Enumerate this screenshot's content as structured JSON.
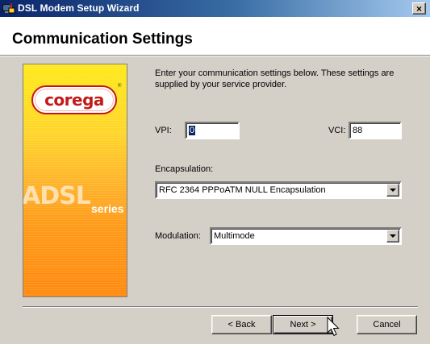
{
  "window": {
    "title": "DSL Modem Setup Wizard",
    "close_glyph": "×"
  },
  "header": {
    "title": "Communication Settings"
  },
  "banner": {
    "logo_text": "corega",
    "logo_reg": "®",
    "product_text": "ADSL",
    "series_text": "series"
  },
  "content": {
    "intro": "Enter your communication settings below.  These settings are supplied by your service provider.",
    "vpi": {
      "label": "VPI:",
      "value": "0"
    },
    "vci": {
      "label": "VCI:",
      "value": "88"
    },
    "encapsulation": {
      "label": "Encapsulation:",
      "selected": "RFC 2364 PPPoATM NULL Encapsulation"
    },
    "modulation": {
      "label": "Modulation:",
      "selected": "Multimode"
    }
  },
  "buttons": {
    "back": "< Back",
    "next": "Next >",
    "cancel": "Cancel"
  },
  "icons": {
    "title_icon": "wizard-app-icon",
    "close_icon": "close-icon",
    "dropdown_icon": "chevron-down-icon",
    "cursor_icon": "mouse-pointer-icon"
  },
  "colors": {
    "titlebar_start": "#0a246a",
    "titlebar_end": "#a6caf0",
    "face": "#d4d0c8",
    "banner_top": "#ffe91a",
    "banner_bottom": "#ff8a10",
    "logo_red": "#c21a1a"
  }
}
